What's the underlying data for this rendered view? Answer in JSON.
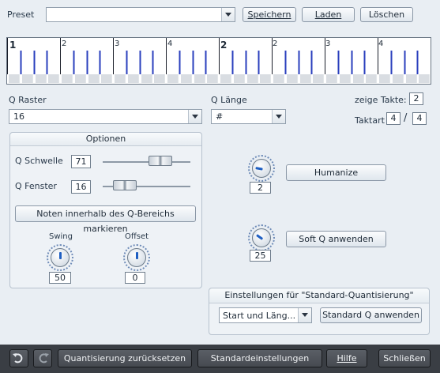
{
  "preset": {
    "label": "Preset",
    "value": "",
    "save": "Speichern",
    "load": "Laden",
    "delete": "Löschen"
  },
  "ruler": {
    "labels": [
      "1",
      "2",
      "3",
      "4",
      "2",
      "2",
      "3",
      "4"
    ]
  },
  "q_raster": {
    "label": "Q Raster",
    "value": "16"
  },
  "q_laenge": {
    "label": "Q Länge",
    "value": "#"
  },
  "takte": {
    "show_label": "zeige Takte:",
    "show_value": "2",
    "taktart_label": "Taktart",
    "taktart_num": "4",
    "taktart_sep": "/",
    "taktart_den": "4"
  },
  "optionen": {
    "title": "Optionen",
    "schwelle_label": "Q Schwelle",
    "schwelle_value": "71",
    "schwelle_level": 0.71,
    "fenster_label": "Q Fenster",
    "fenster_value": "16",
    "fenster_level": 0.16,
    "mark_button": "Noten innerhalb des Q-Bereichs markieren",
    "swing_label": "Swing",
    "swing_value": "50",
    "offset_label": "Offset",
    "offset_value": "0"
  },
  "humanize": {
    "button": "Humanize",
    "value": "2"
  },
  "softq": {
    "button": "Soft Q anwenden",
    "value": "25"
  },
  "standard": {
    "title": "Einstellungen für \"Standard-Quantisierung\"",
    "select": "Start und Läng...",
    "button": "Standard Q anwenden"
  },
  "footer": {
    "reset": "Quantisierung zurücksetzen",
    "defaults": "Standardeinstellungen",
    "help": "Hilfe",
    "close": "Schließen"
  },
  "colors": {
    "accent": "#2a3fbd",
    "background": "#e9eef3",
    "footer": "#3a3e44"
  },
  "icons": {
    "undo": "undo-icon",
    "redo": "redo-icon"
  }
}
